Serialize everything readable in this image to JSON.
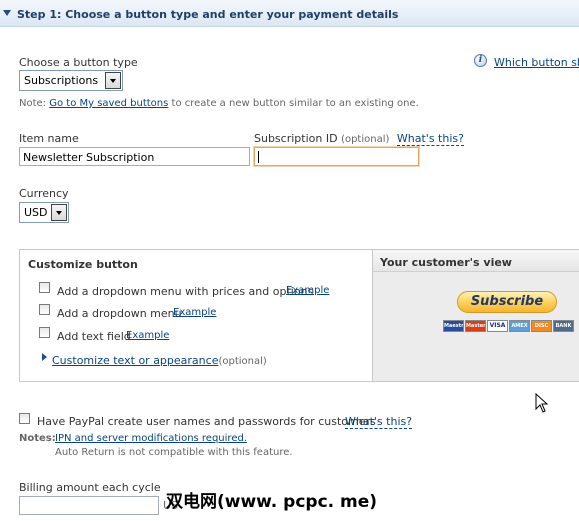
{
  "step": {
    "title": "Step 1: Choose a button type and enter your payment details"
  },
  "button_type": {
    "label": "Choose a button type",
    "selected": "Subscriptions",
    "which_link": "Which button shou"
  },
  "note": {
    "prefix": "Note:",
    "link": "Go to My saved buttons",
    "suffix": "to create a new button similar to an existing one."
  },
  "item_name": {
    "label": "Item name",
    "value": "Newsletter Subscription"
  },
  "subscription_id": {
    "label": "Subscription ID",
    "optional": "(optional)",
    "help": "What's this?",
    "value": ""
  },
  "currency": {
    "label": "Currency",
    "selected": "USD"
  },
  "customize": {
    "title": "Customize button",
    "options": [
      {
        "label": "Add a dropdown menu with prices and options",
        "example": "Example",
        "checked": false
      },
      {
        "label": "Add a dropdown menu",
        "example": "Example",
        "checked": false
      },
      {
        "label": "Add text field",
        "example": "Example",
        "checked": false
      }
    ],
    "appearance_link": "Customize text or appearance",
    "appearance_optional": "(optional)"
  },
  "preview": {
    "title": "Your customer's view",
    "button_label": "Subscribe",
    "cards": [
      "Maestro",
      "MasterCard",
      "VISA",
      "AmEx",
      "DISCOVER",
      "BANK"
    ]
  },
  "paypal_users": {
    "label": "Have PayPal create user names and passwords for customers",
    "help": "What's this?",
    "checked": false,
    "notes_label": "Notes:",
    "notes_link": "IPN and server modifications required.",
    "notes_line2": "Auto Return is not compatible with this feature."
  },
  "billing": {
    "label": "Billing amount each cycle",
    "value": "",
    "unit_partial": "US"
  },
  "watermark": "双电网(www. pcpc. me)",
  "colors": {
    "header_text": "#1f3f6a",
    "link": "#084482",
    "focus_border": "#e4a55a",
    "subscribe_gold": "#ffd15c"
  }
}
